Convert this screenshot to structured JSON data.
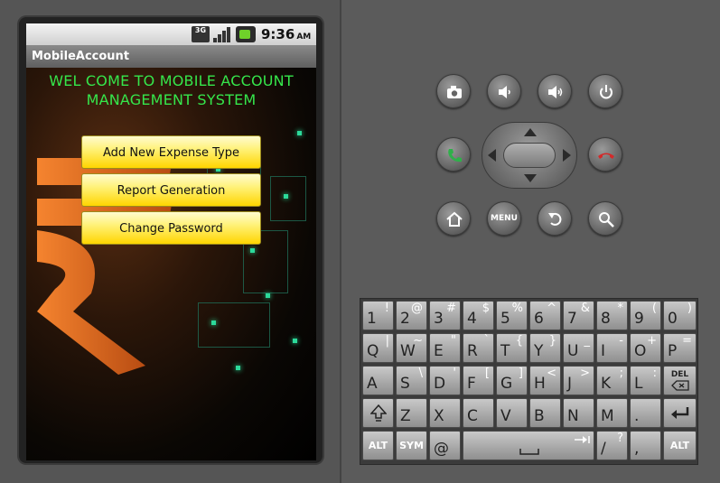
{
  "status_bar": {
    "network": "3G",
    "time": "9:36",
    "ampm": "AM"
  },
  "app": {
    "title": "MobileAccount",
    "welcome_line1": "WEL COME TO MOBILE ACCOUNT",
    "welcome_line2": "MANAGEMENT SYSTEM",
    "buttons": {
      "add_expense": "Add New Expense Type",
      "report": "Report Generation",
      "change_password": "Change Password"
    }
  },
  "controls": {
    "menu_label": "MENU",
    "icons": [
      "camera-icon",
      "volume-down-icon",
      "volume-up-icon",
      "power-icon",
      "call-icon",
      "end-call-icon",
      "home-icon",
      "back-icon",
      "search-icon"
    ]
  },
  "keyboard": {
    "row1": [
      {
        "main": "1",
        "alt": "!"
      },
      {
        "main": "2",
        "alt": "@"
      },
      {
        "main": "3",
        "alt": "#"
      },
      {
        "main": "4",
        "alt": "$"
      },
      {
        "main": "5",
        "alt": "%"
      },
      {
        "main": "6",
        "alt": "^"
      },
      {
        "main": "7",
        "alt": "&"
      },
      {
        "main": "8",
        "alt": "*"
      },
      {
        "main": "9",
        "alt": "("
      },
      {
        "main": "0",
        "alt": ")"
      }
    ],
    "row2": [
      {
        "main": "Q",
        "alt": "|"
      },
      {
        "main": "W",
        "alt": "~"
      },
      {
        "main": "E",
        "alt": "\""
      },
      {
        "main": "R",
        "alt": "`"
      },
      {
        "main": "T",
        "alt": "{"
      },
      {
        "main": "Y",
        "alt": "}"
      },
      {
        "main": "U",
        "alt": "_"
      },
      {
        "main": "I",
        "alt": "-"
      },
      {
        "main": "O",
        "alt": "+"
      },
      {
        "main": "P",
        "alt": "="
      }
    ],
    "row3": [
      {
        "main": "A",
        "alt": ""
      },
      {
        "main": "S",
        "alt": "\\"
      },
      {
        "main": "D",
        "alt": "'"
      },
      {
        "main": "F",
        "alt": "["
      },
      {
        "main": "G",
        "alt": "]"
      },
      {
        "main": "H",
        "alt": "<"
      },
      {
        "main": "J",
        "alt": ">"
      },
      {
        "main": "K",
        "alt": ";"
      },
      {
        "main": "L",
        "alt": ":"
      }
    ],
    "del_label": "DEL",
    "row4": [
      "Z",
      "X",
      "C",
      "V",
      "B",
      "N",
      "M",
      "."
    ],
    "alt_label": "ALT",
    "sym_label": "SYM",
    "at_label": "@",
    "row5_keys": [
      {
        "main": "/",
        "alt": "?"
      },
      {
        "main": ",",
        "alt": ""
      }
    ]
  }
}
